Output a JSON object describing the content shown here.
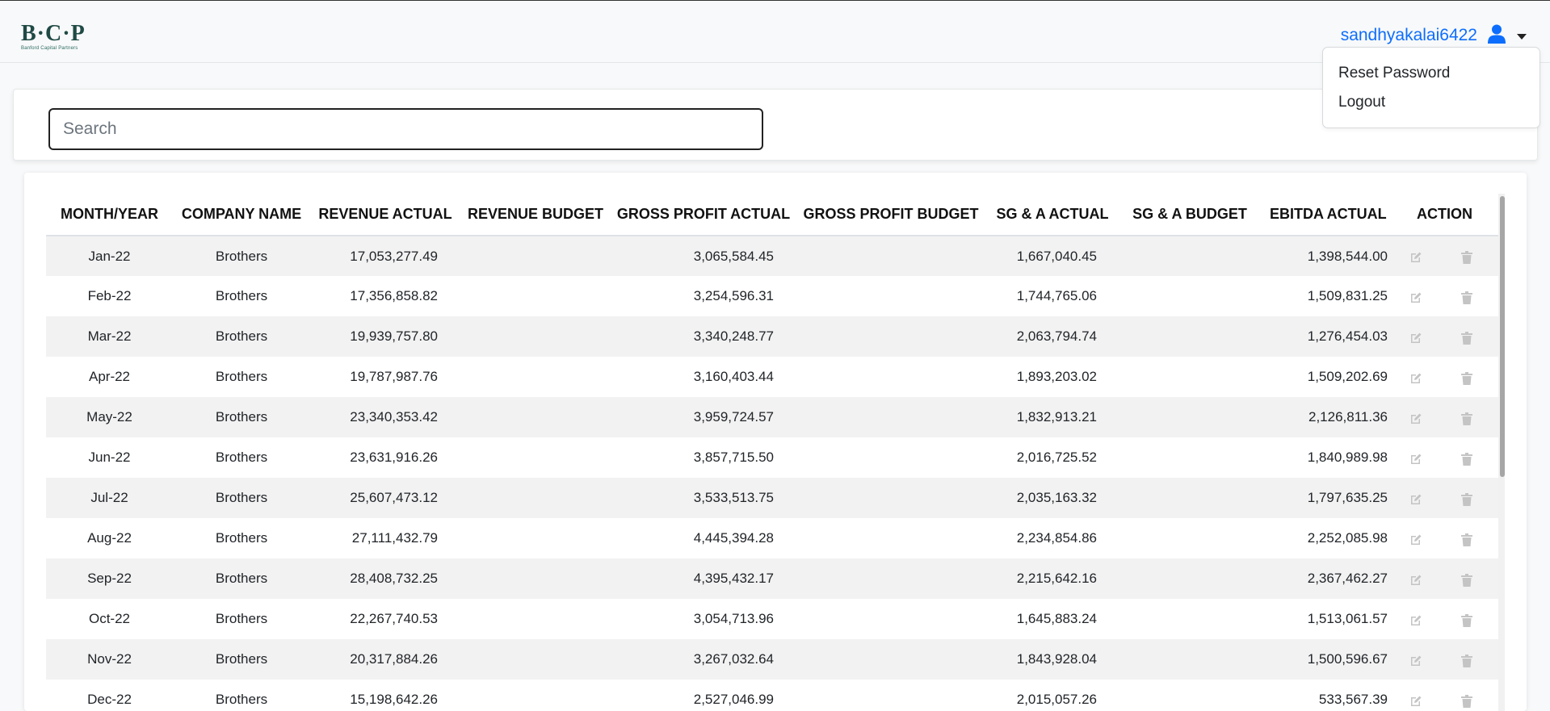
{
  "header": {
    "logo_text": "B·C·P",
    "logo_subtext": "Banford Capital Partners",
    "username": "sandhyakalai6422"
  },
  "user_menu": {
    "items": [
      {
        "label": "Reset Password"
      },
      {
        "label": "Logout"
      }
    ]
  },
  "search": {
    "placeholder": "Search",
    "value": ""
  },
  "table": {
    "columns": [
      "MONTH/YEAR",
      "COMPANY NAME",
      "REVENUE ACTUAL",
      "REVENUE BUDGET",
      "GROSS PROFIT ACTUAL",
      "GROSS PROFIT BUDGET",
      "SG & A ACTUAL",
      "SG & A BUDGET",
      "EBITDA ACTUAL",
      "ACTION"
    ],
    "rows": [
      {
        "month": "Jan-22",
        "company": "Brothers",
        "revenue_actual": "17,053,277.49",
        "revenue_budget": "",
        "gp_actual": "3,065,584.45",
        "gp_budget": "",
        "sga_actual": "1,667,040.45",
        "sga_budget": "",
        "ebitda_actual": "1,398,544.00"
      },
      {
        "month": "Feb-22",
        "company": "Brothers",
        "revenue_actual": "17,356,858.82",
        "revenue_budget": "",
        "gp_actual": "3,254,596.31",
        "gp_budget": "",
        "sga_actual": "1,744,765.06",
        "sga_budget": "",
        "ebitda_actual": "1,509,831.25"
      },
      {
        "month": "Mar-22",
        "company": "Brothers",
        "revenue_actual": "19,939,757.80",
        "revenue_budget": "",
        "gp_actual": "3,340,248.77",
        "gp_budget": "",
        "sga_actual": "2,063,794.74",
        "sga_budget": "",
        "ebitda_actual": "1,276,454.03"
      },
      {
        "month": "Apr-22",
        "company": "Brothers",
        "revenue_actual": "19,787,987.76",
        "revenue_budget": "",
        "gp_actual": "3,160,403.44",
        "gp_budget": "",
        "sga_actual": "1,893,203.02",
        "sga_budget": "",
        "ebitda_actual": "1,509,202.69"
      },
      {
        "month": "May-22",
        "company": "Brothers",
        "revenue_actual": "23,340,353.42",
        "revenue_budget": "",
        "gp_actual": "3,959,724.57",
        "gp_budget": "",
        "sga_actual": "1,832,913.21",
        "sga_budget": "",
        "ebitda_actual": "2,126,811.36"
      },
      {
        "month": "Jun-22",
        "company": "Brothers",
        "revenue_actual": "23,631,916.26",
        "revenue_budget": "",
        "gp_actual": "3,857,715.50",
        "gp_budget": "",
        "sga_actual": "2,016,725.52",
        "sga_budget": "",
        "ebitda_actual": "1,840,989.98"
      },
      {
        "month": "Jul-22",
        "company": "Brothers",
        "revenue_actual": "25,607,473.12",
        "revenue_budget": "",
        "gp_actual": "3,533,513.75",
        "gp_budget": "",
        "sga_actual": "2,035,163.32",
        "sga_budget": "",
        "ebitda_actual": "1,797,635.25"
      },
      {
        "month": "Aug-22",
        "company": "Brothers",
        "revenue_actual": "27,111,432.79",
        "revenue_budget": "",
        "gp_actual": "4,445,394.28",
        "gp_budget": "",
        "sga_actual": "2,234,854.86",
        "sga_budget": "",
        "ebitda_actual": "2,252,085.98"
      },
      {
        "month": "Sep-22",
        "company": "Brothers",
        "revenue_actual": "28,408,732.25",
        "revenue_budget": "",
        "gp_actual": "4,395,432.17",
        "gp_budget": "",
        "sga_actual": "2,215,642.16",
        "sga_budget": "",
        "ebitda_actual": "2,367,462.27"
      },
      {
        "month": "Oct-22",
        "company": "Brothers",
        "revenue_actual": "22,267,740.53",
        "revenue_budget": "",
        "gp_actual": "3,054,713.96",
        "gp_budget": "",
        "sga_actual": "1,645,883.24",
        "sga_budget": "",
        "ebitda_actual": "1,513,061.57"
      },
      {
        "month": "Nov-22",
        "company": "Brothers",
        "revenue_actual": "20,317,884.26",
        "revenue_budget": "",
        "gp_actual": "3,267,032.64",
        "gp_budget": "",
        "sga_actual": "1,843,928.04",
        "sga_budget": "",
        "ebitda_actual": "1,500,596.67"
      },
      {
        "month": "Dec-22",
        "company": "Brothers",
        "revenue_actual": "15,198,642.26",
        "revenue_budget": "",
        "gp_actual": "2,527,046.99",
        "gp_budget": "",
        "sga_actual": "2,015,057.26",
        "sga_budget": "",
        "ebitda_actual": "533,567.39"
      }
    ]
  },
  "colors": {
    "link": "#0d6efd",
    "logo": "#1f4a45",
    "icon_gray": "#c4c4c4",
    "stripe": "#f2f2f2"
  },
  "icons": [
    "user-icon",
    "caret-down-icon",
    "edit-icon",
    "trash-icon"
  ]
}
